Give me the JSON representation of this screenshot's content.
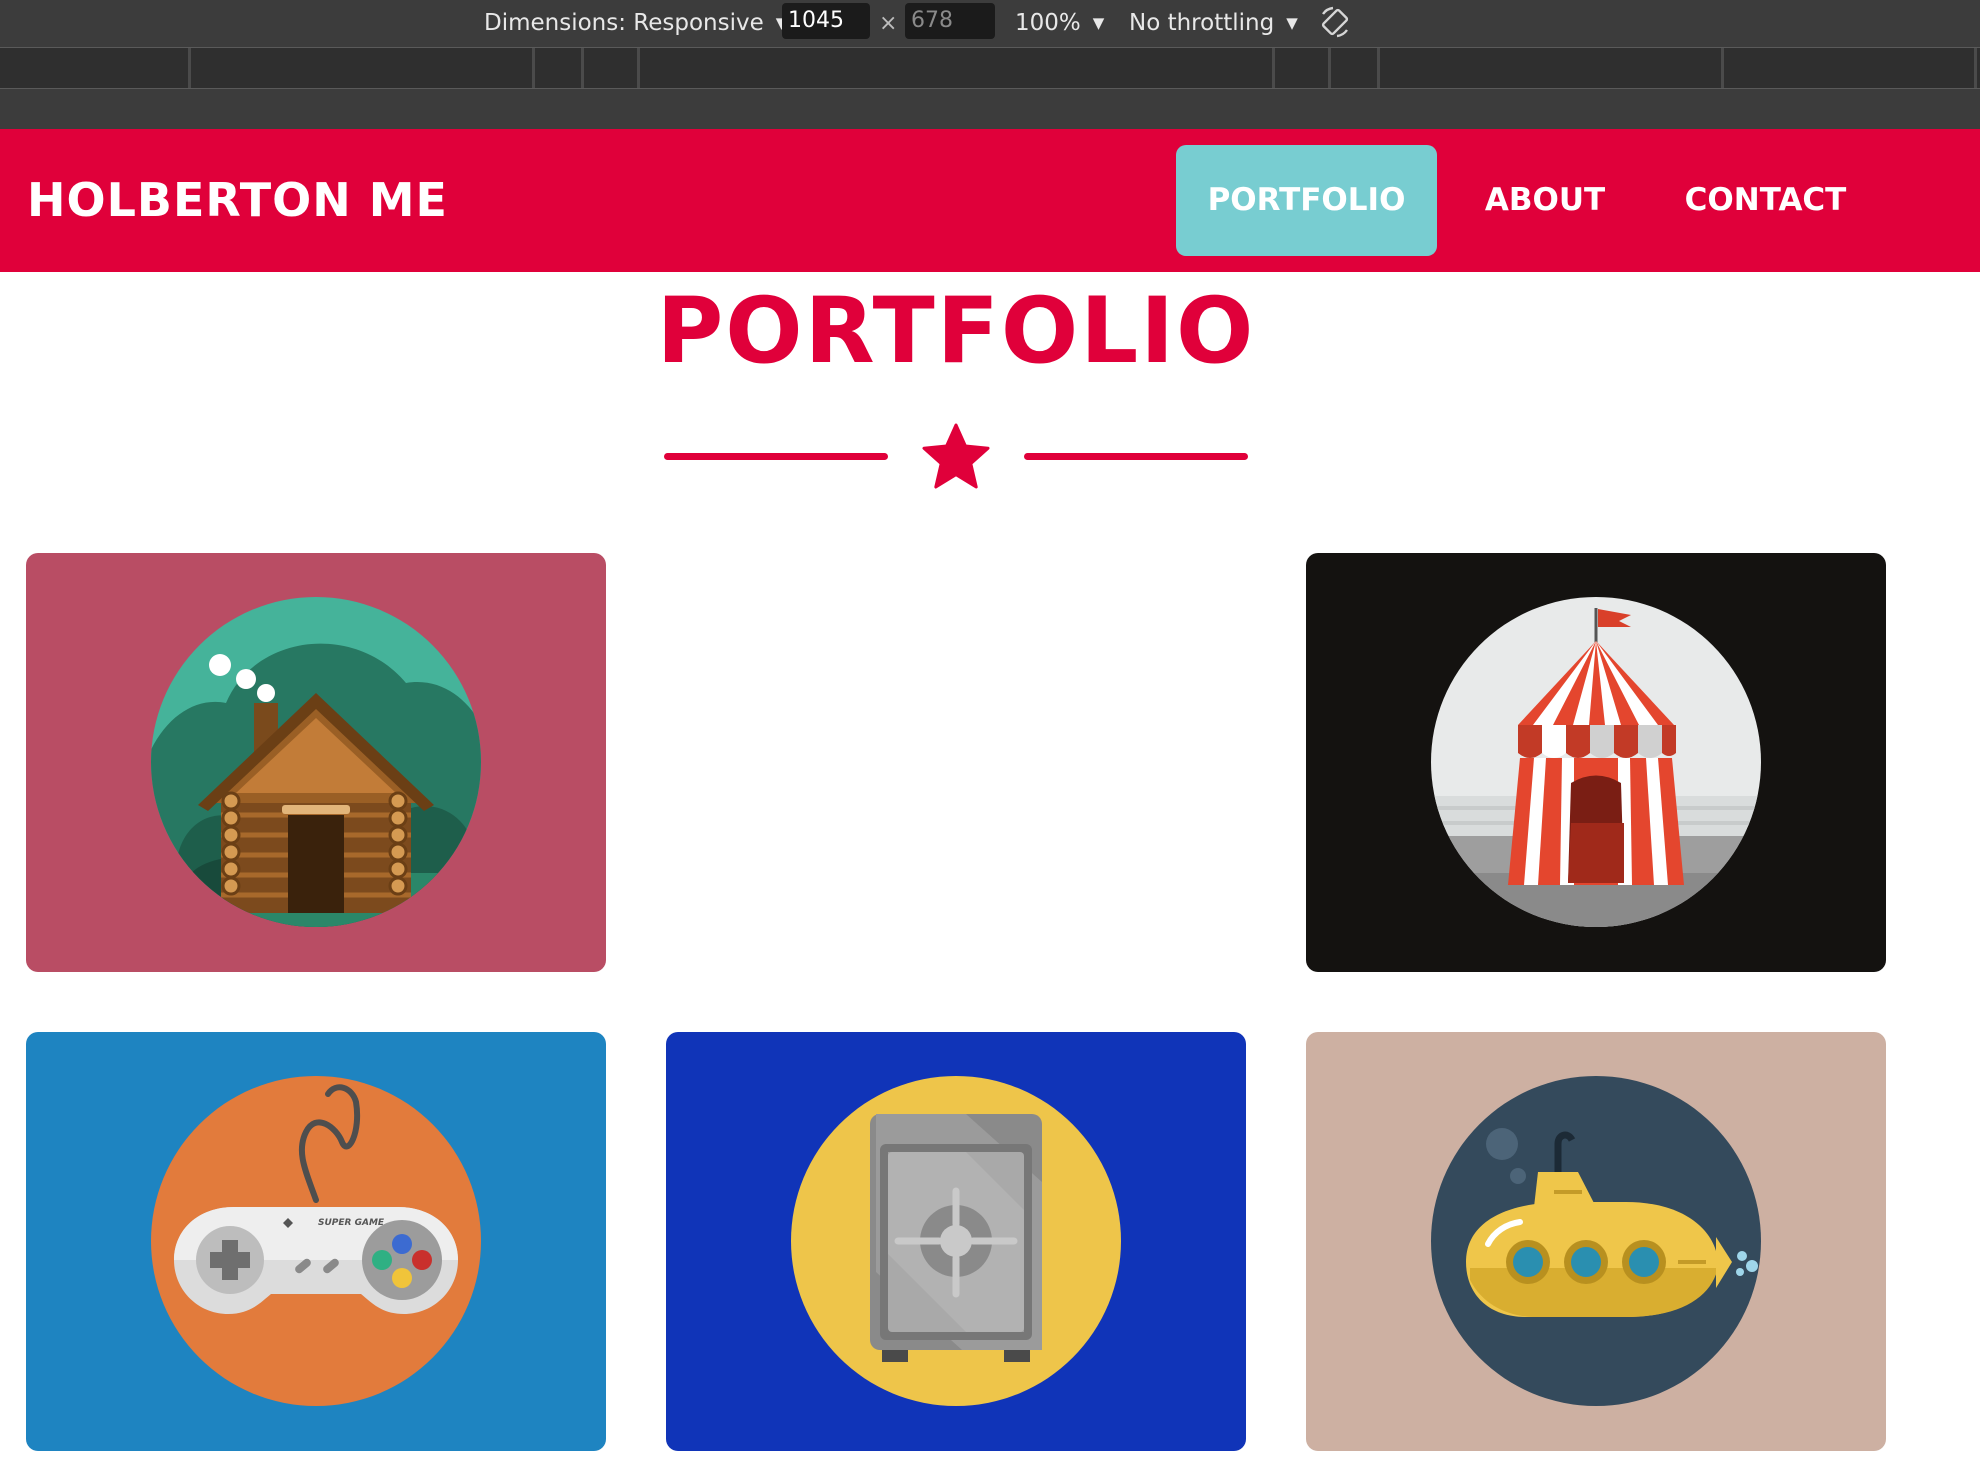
{
  "devtools": {
    "dimensions_label": "Dimensions: Responsive",
    "width_value": "1045",
    "height_value": "678",
    "times_symbol": "×",
    "zoom_label": "100%",
    "throttling_label": "No throttling",
    "caret_icon": "▼"
  },
  "header": {
    "brand": "HOLBERTON ME",
    "nav": [
      {
        "label": "PORTFOLIO",
        "active": true
      },
      {
        "label": "ABOUT",
        "active": false
      },
      {
        "label": "CONTACT",
        "active": false
      }
    ]
  },
  "portfolio": {
    "title": "PORTFOLIO",
    "divider_icon": "star-icon",
    "items": [
      {
        "icon": "log-cabin-icon",
        "background": "#b94d64",
        "circle": "#45b39a"
      },
      {
        "icon": "circus-tent-icon",
        "background": "#141210",
        "circle": "#e8eaea"
      },
      {
        "icon": "game-controller-icon",
        "background": "#1e84c1",
        "circle": "#e27b3c"
      },
      {
        "icon": "safe-icon",
        "background": "#1034b8",
        "circle": "#eec54a"
      },
      {
        "icon": "submarine-icon",
        "background": "#cdb0a2",
        "circle": "#344a5c"
      }
    ],
    "controller_text": "SUPER GAME"
  },
  "colors": {
    "brand_red": "#e0003a",
    "active_nav": "#78cdd1",
    "devtools_bg": "#3c3c3c"
  }
}
